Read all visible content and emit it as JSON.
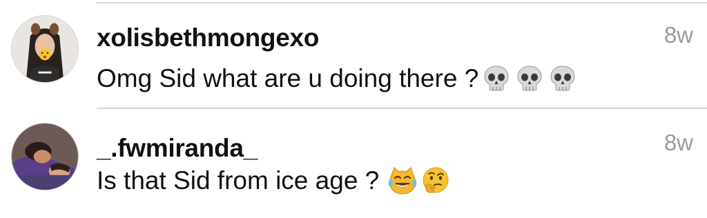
{
  "comments": [
    {
      "username": "xolisbethmongexo",
      "timestamp": "8w",
      "text": "Omg Sid what are u doing there ?",
      "emojis": [
        "skull-emoji",
        "skull-emoji",
        "skull-emoji"
      ]
    },
    {
      "username": "_.fwmiranda_",
      "timestamp": "8w",
      "text": "Is that Sid from ice age ?",
      "emojis": [
        "cat-tears-of-joy-emoji",
        "thinking-face-emoji"
      ]
    }
  ],
  "colors": {
    "username": "#111111",
    "text": "#111111",
    "timestamp": "#9b9b9b",
    "divider": "#d6d6d6",
    "background": "#ffffff"
  }
}
